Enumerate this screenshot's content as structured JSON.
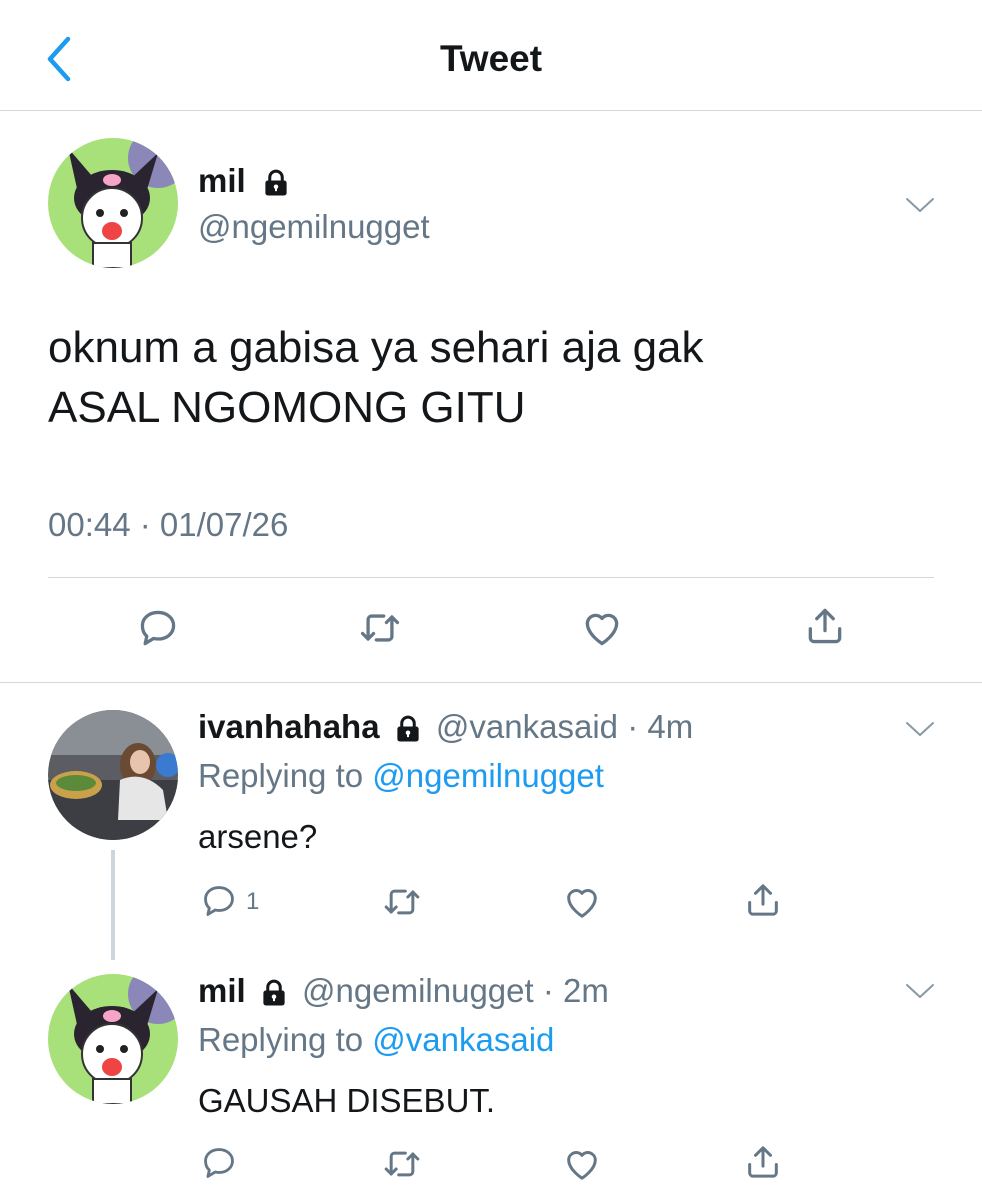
{
  "header": {
    "title": "Tweet"
  },
  "main_tweet": {
    "name": "mil",
    "handle": "@ngemilnugget",
    "text_line1": "oknum a gabisa ya sehari aja gak",
    "text_line2": "ASAL NGOMONG GITU",
    "timestamp": "00:44 · 01/07/26"
  },
  "replies": [
    {
      "name": "ivanhahaha",
      "handle": "@vankasaid",
      "time": "· 4m",
      "replying_label": "Replying to",
      "replying_to": "@ngemilnugget",
      "text": "arsene?",
      "reply_count": "1"
    },
    {
      "name": "mil",
      "handle": "@ngemilnugget",
      "time": "· 2m",
      "replying_label": "Replying to",
      "replying_to": "@vankasaid",
      "text": "GAUSAH DISEBUT."
    }
  ],
  "colors": {
    "accent": "#1d9bf0",
    "secondary_text": "#657786",
    "divider": "#d3d8de"
  },
  "icons": [
    "chevron-left-icon",
    "lock-icon",
    "chevron-down-icon",
    "reply-icon",
    "retweet-icon",
    "like-icon",
    "share-icon"
  ]
}
